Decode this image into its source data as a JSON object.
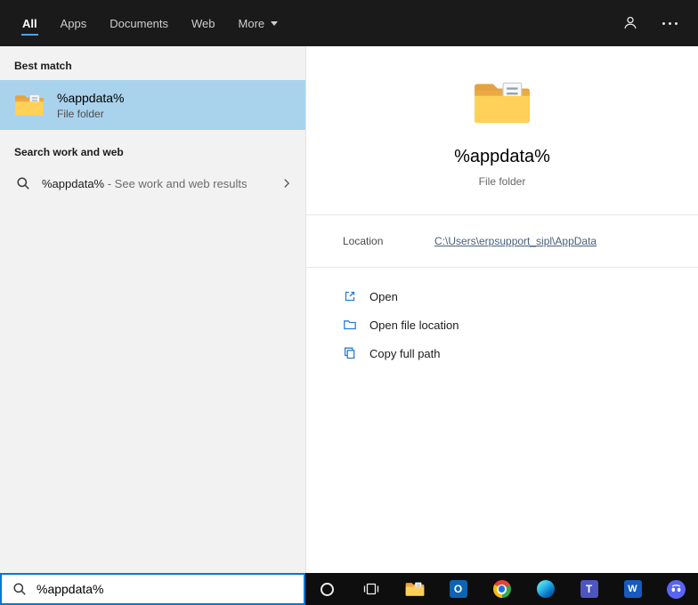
{
  "header": {
    "tabs": [
      {
        "label": "All",
        "active": true
      },
      {
        "label": "Apps",
        "active": false
      },
      {
        "label": "Documents",
        "active": false
      },
      {
        "label": "Web",
        "active": false
      },
      {
        "label": "More",
        "active": false,
        "has_dropdown": true
      }
    ],
    "icons": [
      "account-icon",
      "more-options-icon"
    ]
  },
  "left_panel": {
    "best_match_title": "Best match",
    "best_match_item": {
      "title": "%appdata%",
      "subtitle": "File folder",
      "icon": "folder-icon",
      "selected": true
    },
    "search_web_title": "Search work and web",
    "search_web_item": {
      "query": "%appdata%",
      "suffix": " - See work and web results",
      "icon": "search-icon"
    }
  },
  "preview": {
    "icon": "folder-icon",
    "title": "%appdata%",
    "subtitle": "File folder",
    "location_label": "Location",
    "location_value": "C:\\Users\\erpsupport_sipl\\AppData",
    "actions": [
      {
        "label": "Open",
        "icon": "open-icon"
      },
      {
        "label": "Open file location",
        "icon": "open-file-location-icon"
      },
      {
        "label": "Copy full path",
        "icon": "copy-icon"
      }
    ]
  },
  "search_box": {
    "value": "%appdata%",
    "icon": "search-icon"
  },
  "taskbar": {
    "items": [
      {
        "name": "cortana-icon",
        "glyph": ""
      },
      {
        "name": "task-view-icon",
        "glyph": ""
      },
      {
        "name": "file-explorer-icon",
        "glyph": ""
      },
      {
        "name": "outlook-icon",
        "glyph": "O"
      },
      {
        "name": "chrome-icon",
        "glyph": ""
      },
      {
        "name": "edge-icon",
        "glyph": ""
      },
      {
        "name": "teams-icon",
        "glyph": "T"
      },
      {
        "name": "word-icon",
        "glyph": "W"
      },
      {
        "name": "discord-icon",
        "glyph": ""
      }
    ]
  },
  "colors": {
    "accent": "#0078d7",
    "selection_highlight": "#a9d2ec",
    "active_tab_underline": "#4fa3e3",
    "header_background": "#1a1a1a",
    "panel_background": "#f2f2f2"
  }
}
